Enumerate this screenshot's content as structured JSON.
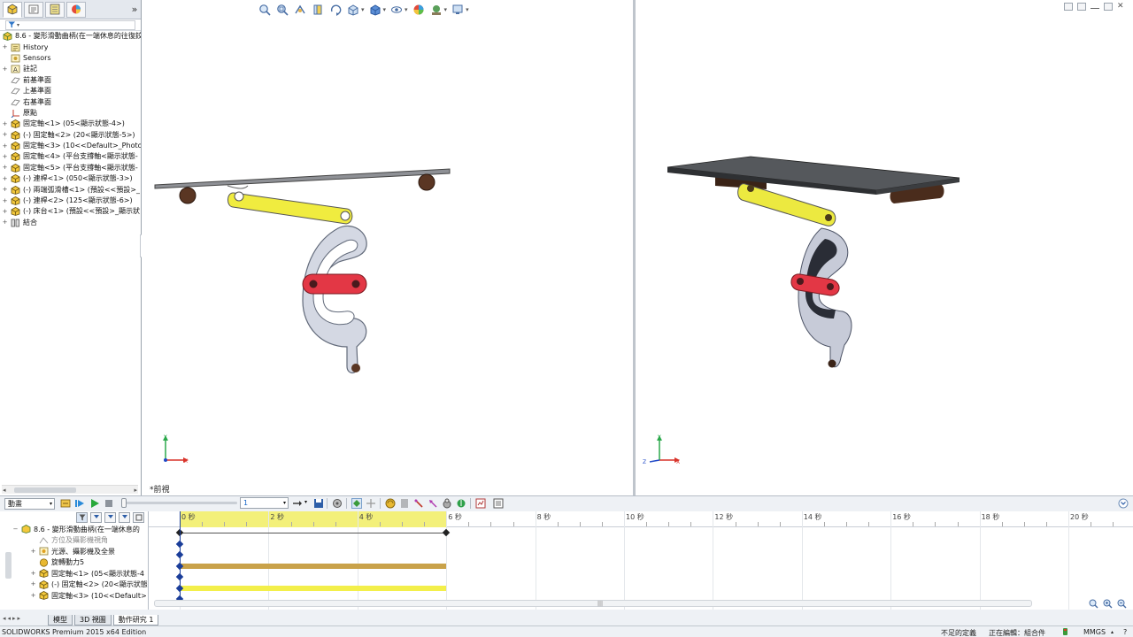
{
  "feature_tree": {
    "filter_icon": "filter-icon",
    "root": "8.6 - 變形滑動曲柄(在一端休息的往復鉸",
    "items": [
      {
        "label": "History",
        "icon": "history-icon",
        "expand": "+"
      },
      {
        "label": "Sensors",
        "icon": "sensor-icon",
        "expand": ""
      },
      {
        "label": "註記",
        "icon": "annotation-icon",
        "expand": "+"
      },
      {
        "label": "前基準面",
        "icon": "plane-icon",
        "expand": ""
      },
      {
        "label": "上基準面",
        "icon": "plane-icon",
        "expand": ""
      },
      {
        "label": "右基準面",
        "icon": "plane-icon",
        "expand": ""
      },
      {
        "label": "原點",
        "icon": "origin-icon",
        "expand": ""
      },
      {
        "label": "固定軸<1> (05<顯示狀態-4>)",
        "icon": "part-icon",
        "expand": "+"
      },
      {
        "label": "(-) 固定軸<2> (20<顯示狀態-5>)",
        "icon": "part-icon",
        "expand": "+"
      },
      {
        "label": "固定軸<3> (10<<Default>_Photo",
        "icon": "part-icon",
        "expand": "+"
      },
      {
        "label": "固定軸<4> (平台支撐軸<顯示狀態-",
        "icon": "part-icon",
        "expand": "+"
      },
      {
        "label": "固定軸<5> (平台支撐軸<顯示狀態-",
        "icon": "part-icon",
        "expand": "+"
      },
      {
        "label": "(-) 連桿<1> (050<顯示狀態-3>)",
        "icon": "part-icon",
        "expand": "+"
      },
      {
        "label": "(-) 兩端弧滑槽<1> (預設<<預設>_",
        "icon": "part-icon",
        "expand": "+"
      },
      {
        "label": "(-) 連桿<2> (125<顯示狀態-6>)",
        "icon": "part-icon",
        "expand": "+"
      },
      {
        "label": "(-) 床台<1> (預設<<預設>_顯示狀",
        "icon": "part-icon",
        "expand": "+"
      },
      {
        "label": "結合",
        "icon": "mate-icon",
        "expand": "+"
      }
    ]
  },
  "viewport": {
    "view_label": "*前視",
    "axis_x": "X",
    "axis_y": "Y",
    "axis_z": "Z"
  },
  "motion_study": {
    "study_type": "動畫",
    "time_value": "1",
    "ruler_labels": [
      "0 秒",
      "2 秒",
      "4 秒",
      "6 秒",
      "8 秒",
      "10 秒",
      "12 秒",
      "14 秒",
      "16 秒",
      "18 秒",
      "20 秒"
    ],
    "tree": {
      "root": "8.6 - 變形滑動曲柄(在一端休息的",
      "rows": [
        {
          "label": "方位及攝影機視角",
          "expand": "",
          "dim": true
        },
        {
          "label": "光源、攝影機及全景",
          "expand": "+",
          "dim": false
        },
        {
          "label": "旋轉動力5",
          "expand": "",
          "dim": false
        },
        {
          "label": "固定軸<1> (05<顯示狀態-4",
          "expand": "+",
          "dim": false
        },
        {
          "label": "(-) 固定軸<2> (20<顯示狀態",
          "expand": "+",
          "dim": false
        },
        {
          "label": "固定軸<3> (10<<Default>",
          "expand": "+",
          "dim": false
        }
      ]
    },
    "tabs": [
      "模型",
      "3D 視圖",
      "動作研究 1"
    ],
    "active_tab": "動作研究 1",
    "duration_seconds": 6,
    "colors": {
      "motor_bar": "#c9a24a",
      "part_bar": "#f3ef4a",
      "ruler_highlight": "#f3f07a"
    }
  },
  "statusbar": {
    "product": "SOLIDWORKS Premium 2015 x64 Edition",
    "definition": "不足的定義",
    "editing": "正在編輯：組合件",
    "units": "MMGS",
    "units_arrow": "▴",
    "help": "?"
  }
}
